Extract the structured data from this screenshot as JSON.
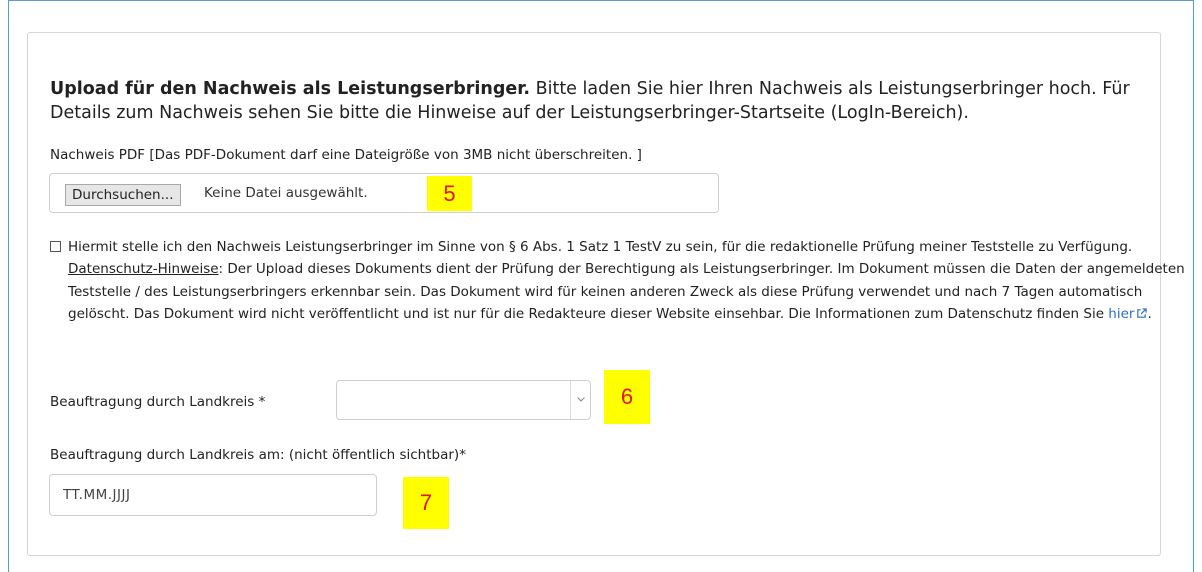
{
  "intro": {
    "bold": "Upload für den Nachweis als Leistungserbringer.",
    "text": " Bitte laden Sie hier Ihren Nachweis als Leistungserbringer hoch. Für Details zum Nachweis sehen Sie bitte die Hinweise auf der Leistungserbringer-Startseite (LogIn-Bereich)."
  },
  "upload": {
    "label": "Nachweis PDF [Das PDF-Dokument darf eine Dateigröße von 3MB nicht überschreiten. ]",
    "button": "Durchsuchen...",
    "status": "Keine Datei ausgewählt."
  },
  "consent": {
    "checked": false,
    "text_before": "Hiermit stelle ich den Nachweis Leistungserbringer im Sinne von § 6 Abs. 1 Satz 1 TestV zu sein, für die redaktionelle Prüfung meiner Teststelle zu Verfügung. ",
    "privacy_link": "Datenschutz-Hinweise",
    "text_after": ": Der Upload dieses Dokuments dient der Prüfung der Berechtigung als Leistungserbringer. Im Dokument müssen die Daten der angemeldeten Teststelle / des Leistungserbringers erkennbar sein. Das Dokument wird für keinen anderen Zweck als diese Prüfung verwendet und nach 7 Tagen automatisch gelöscht. Das Dokument wird nicht veröffentlicht und ist nur für die Redakteure dieser Website einsehbar. Die Informationen zum Datenschutz finden Sie ",
    "here_link": "hier",
    "end": "."
  },
  "district": {
    "label": "Beauftragung durch Landkreis *",
    "selected": ""
  },
  "date": {
    "label": "Beauftragung durch Landkreis am: (nicht öffentlich sichtbar)*",
    "placeholder": "TT.MM.JJJJ"
  },
  "badges": {
    "b5": "5",
    "b6": "6",
    "b7": "7"
  },
  "colors": {
    "badge_bg": "#ffff00",
    "badge_text": "#e0161b",
    "link": "#2a6fc9"
  }
}
